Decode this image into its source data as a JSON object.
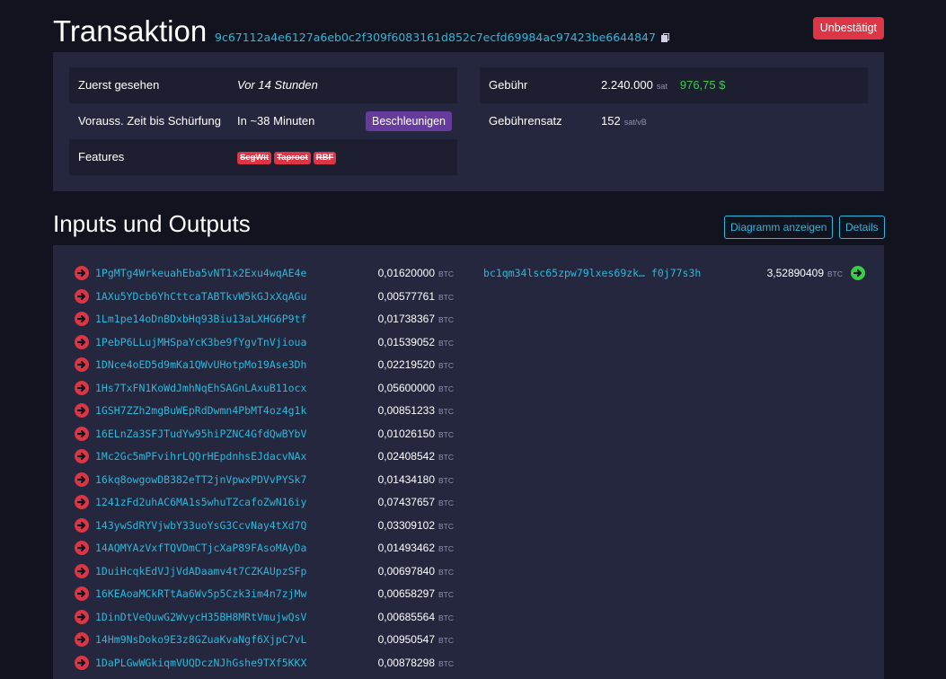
{
  "header": {
    "title": "Transaktion",
    "txid": "9c67112a4e6127a6eb0c2f309f6083161d852c7ecfd69984ac97423be6644847",
    "status": "Unbestätigt"
  },
  "details": {
    "first_seen_label": "Zuerst gesehen",
    "first_seen_value": "Vor 14 Stunden",
    "eta_label": "Vorauss. Zeit bis Schürfung",
    "eta_value": "In ~38 Minuten",
    "accelerate_label": "Beschleunigen",
    "features_label": "Features",
    "features": [
      "SegWit",
      "Taproot",
      "RBF"
    ],
    "fee_label": "Gebühr",
    "fee_value": "2.240.000",
    "fee_unit": "sat",
    "fee_usd": "976,75 $",
    "feerate_label": "Gebührensatz",
    "feerate_value": "152",
    "feerate_unit": "sat/vB"
  },
  "io": {
    "title": "Inputs und Outputs",
    "diagram_button": "Diagramm anzeigen",
    "details_button": "Details",
    "unit": "BTC",
    "inputs": [
      {
        "address": "1PgMTg4WrkeuahEba5vNT1x2Exu4wqAE4e",
        "amount": "0,01620000"
      },
      {
        "address": "1AXu5YDcb6YhCttcaTABTkvW5kGJxXqAGu",
        "amount": "0,00577761"
      },
      {
        "address": "1Lm1pe14oDnBDxbHq93Biu13aLXHG6P9tf",
        "amount": "0,01738367"
      },
      {
        "address": "1PebP6LLujMHSpaYcK3be9fYgvTnVjioua",
        "amount": "0,01539052"
      },
      {
        "address": "1DNce4oED5d9mKa1QWvUHotpMo19Ase3Dh",
        "amount": "0,02219520"
      },
      {
        "address": "1Hs7TxFN1KoWdJmhNqEhSAGnLAxuB11ocx",
        "amount": "0,05600000"
      },
      {
        "address": "1GSH7ZZh2mgBuWEpRdDwmn4PbMT4oz4g1k",
        "amount": "0,00851233"
      },
      {
        "address": "16ELnZa3SFJTudYw95hiPZNC4GfdQwBYbV",
        "amount": "0,01026150"
      },
      {
        "address": "1Mc2Gc5mPFvihrLQQrHEpdnhsEJdacvNAx",
        "amount": "0,02408542"
      },
      {
        "address": "16kq8owgowDB382eTT2jnVpwxPDVvPYSk7",
        "amount": "0,01434180"
      },
      {
        "address": "1241zFd2uhAC6MA1s5whuTZcafoZwN16iy",
        "amount": "0,07437657"
      },
      {
        "address": "143ywSdRYVjwbY33uoYsG3CcvNay4tXd7Q",
        "amount": "0,03309102"
      },
      {
        "address": "14AQMYAzVxfTQVDmCTjcXaP89FAsoMAyDa",
        "amount": "0,01493462"
      },
      {
        "address": "1DuiHcqkEdVJjVdADaamv4t7CZKAUpzSFp",
        "amount": "0,00697840"
      },
      {
        "address": "16KEAoaMCkRTtAa6Wv5p5Czk3im4n7zjMw",
        "amount": "0,00658297"
      },
      {
        "address": "1DinDtVeQuwG2WvycH35BH8MRtVmujwQsV",
        "amount": "0,00685564"
      },
      {
        "address": "14Hm9NsDoko9E3z8GZuaKvaNgf6XjpC7vL",
        "amount": "0,00950547"
      },
      {
        "address": "1DaPLGwWGkiqmVUQDczNJhGshe9TXf5KKX",
        "amount": "0,00878298"
      }
    ],
    "output": {
      "address": "bc1qm34lsc65zpw79lxes69zk… f0j77s3h",
      "amount": "3,52890409"
    }
  },
  "colors": {
    "background": "#11131f",
    "panel": "#24273e",
    "link": "#2cb8db",
    "danger": "#dc3545",
    "success": "#3bcc49",
    "accelerate": "#653b9c"
  }
}
